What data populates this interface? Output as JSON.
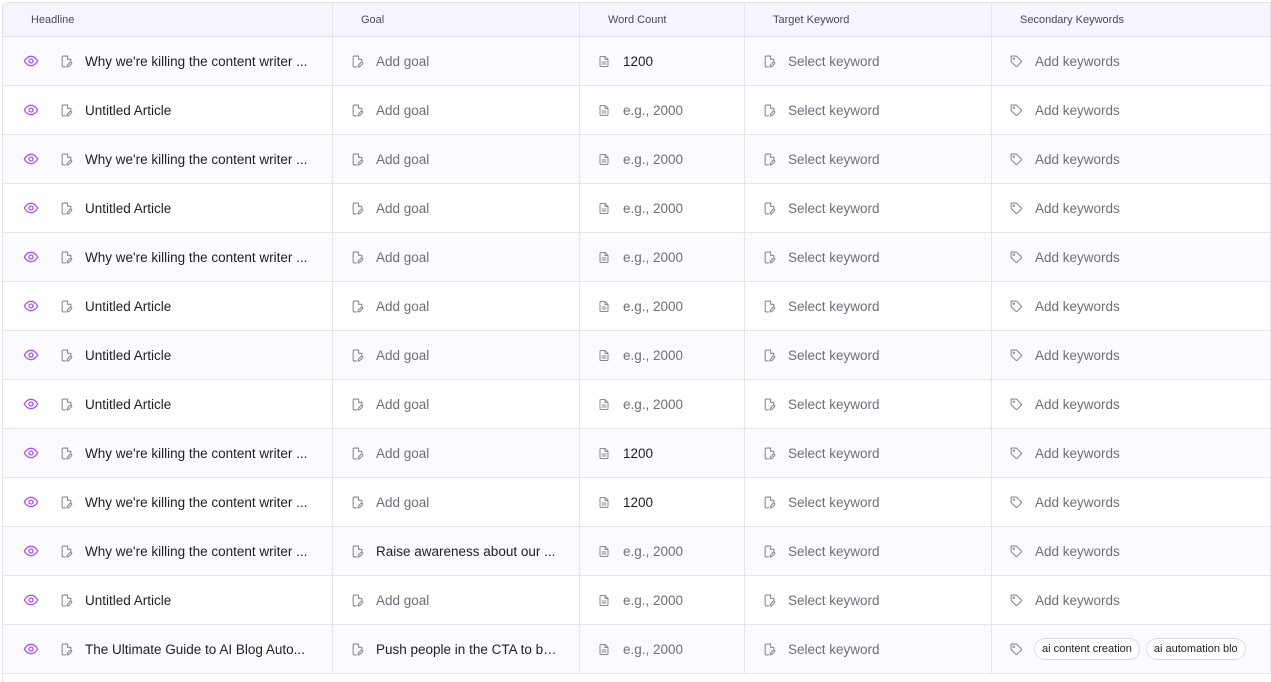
{
  "columns": {
    "headline": "Headline",
    "goal": "Goal",
    "word_count": "Word Count",
    "target_keyword": "Target Keyword",
    "secondary_keywords": "Secondary Keywords"
  },
  "colors": {
    "accent_eye": "#a855f7",
    "icon_gray": "#8a8896",
    "muted_text": "#6f6d7c",
    "header_bg": "#f6f4fd"
  },
  "icons": {
    "view": "eye-icon",
    "headline": "file-edit-icon",
    "goal": "file-edit-icon",
    "word_count": "document-icon",
    "target_keyword": "file-edit-icon",
    "secondary_keywords": "tag-icon"
  },
  "rows": [
    {
      "headline": "Why we're killing the content writer ...",
      "goal": "Add goal",
      "goal_placeholder": true,
      "word_count": "1200",
      "wc_placeholder": false,
      "target_keyword": "Select keyword",
      "secondary": "Add keywords",
      "chips": []
    },
    {
      "headline": "Untitled Article",
      "goal": "Add goal",
      "goal_placeholder": true,
      "word_count": "e.g., 2000",
      "wc_placeholder": true,
      "target_keyword": "Select keyword",
      "secondary": "Add keywords",
      "chips": []
    },
    {
      "headline": "Why we're killing the content writer ...",
      "goal": "Add goal",
      "goal_placeholder": true,
      "word_count": "e.g., 2000",
      "wc_placeholder": true,
      "target_keyword": "Select keyword",
      "secondary": "Add keywords",
      "chips": []
    },
    {
      "headline": "Untitled Article",
      "goal": "Add goal",
      "goal_placeholder": true,
      "word_count": "e.g., 2000",
      "wc_placeholder": true,
      "target_keyword": "Select keyword",
      "secondary": "Add keywords",
      "chips": []
    },
    {
      "headline": "Why we're killing the content writer ...",
      "goal": "Add goal",
      "goal_placeholder": true,
      "word_count": "e.g., 2000",
      "wc_placeholder": true,
      "target_keyword": "Select keyword",
      "secondary": "Add keywords",
      "chips": []
    },
    {
      "headline": "Untitled Article",
      "goal": "Add goal",
      "goal_placeholder": true,
      "word_count": "e.g., 2000",
      "wc_placeholder": true,
      "target_keyword": "Select keyword",
      "secondary": "Add keywords",
      "chips": []
    },
    {
      "headline": "Untitled Article",
      "goal": "Add goal",
      "goal_placeholder": true,
      "word_count": "e.g., 2000",
      "wc_placeholder": true,
      "target_keyword": "Select keyword",
      "secondary": "Add keywords",
      "chips": []
    },
    {
      "headline": "Untitled Article",
      "goal": "Add goal",
      "goal_placeholder": true,
      "word_count": "e.g., 2000",
      "wc_placeholder": true,
      "target_keyword": "Select keyword",
      "secondary": "Add keywords",
      "chips": []
    },
    {
      "headline": "Why we're killing the content writer ...",
      "goal": "Add goal",
      "goal_placeholder": true,
      "word_count": "1200",
      "wc_placeholder": false,
      "target_keyword": "Select keyword",
      "secondary": "Add keywords",
      "chips": []
    },
    {
      "headline": "Why we're killing the content writer ...",
      "goal": "Add goal",
      "goal_placeholder": true,
      "word_count": "1200",
      "wc_placeholder": false,
      "target_keyword": "Select keyword",
      "secondary": "Add keywords",
      "chips": []
    },
    {
      "headline": "Why we're killing the content writer ...",
      "goal": "Raise awareness about our ...",
      "goal_placeholder": false,
      "word_count": "e.g., 2000",
      "wc_placeholder": true,
      "target_keyword": "Select keyword",
      "secondary": "Add keywords",
      "chips": []
    },
    {
      "headline": "Untitled Article",
      "goal": "Add goal",
      "goal_placeholder": true,
      "word_count": "e.g., 2000",
      "wc_placeholder": true,
      "target_keyword": "Select keyword",
      "secondary": "Add keywords",
      "chips": []
    },
    {
      "headline": "The Ultimate Guide to AI Blog Auto...",
      "goal": "Push people in the CTA to bo...",
      "goal_placeholder": false,
      "word_count": "e.g., 2000",
      "wc_placeholder": true,
      "target_keyword": "Select keyword",
      "secondary": "",
      "chips": [
        "ai content creation",
        "ai automation blo"
      ]
    }
  ]
}
